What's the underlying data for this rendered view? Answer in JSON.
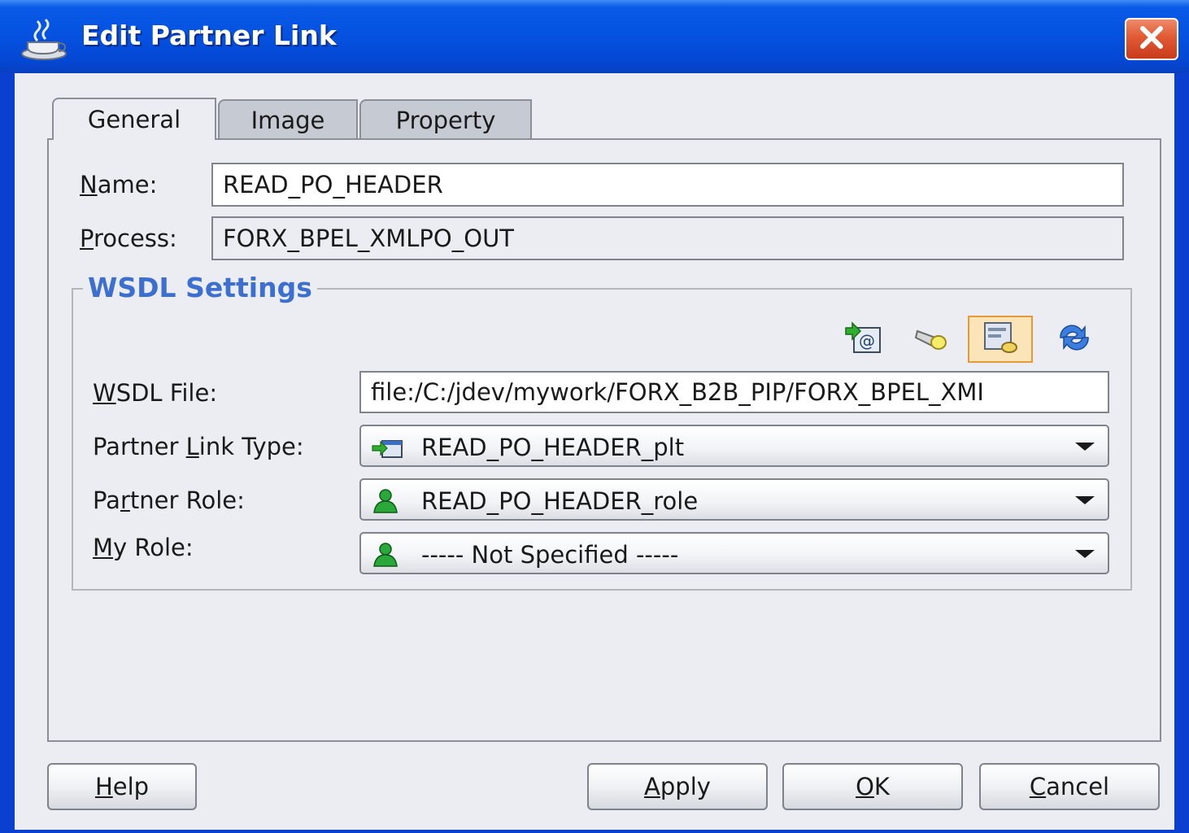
{
  "window": {
    "title": "Edit Partner Link",
    "icon": "coffee-cup-icon",
    "close_icon": "close-icon"
  },
  "tabs": [
    {
      "label": "General",
      "mnemonic": "",
      "active": true
    },
    {
      "label": "Image",
      "active": false
    },
    {
      "label": "Property",
      "active": false
    }
  ],
  "general": {
    "name_label_m": "N",
    "name_label_rest": "ame:",
    "name_value": "READ_PO_HEADER",
    "process_label_m": "P",
    "process_label_rest": "rocess:",
    "process_value": "FORX_BPEL_XMLPO_OUT"
  },
  "wsdl": {
    "group_title": "WSDL Settings",
    "toolbar": [
      "add-wsdl-icon",
      "flashlight-browse-icon",
      "service-explorer-icon",
      "refresh-icon"
    ],
    "wsdl_file_label_pre": "",
    "wsdl_file_label_m": "W",
    "wsdl_file_label_rest": "SDL File:",
    "wsdl_file_value": "file:/C:/jdev/mywork/FORX_B2B_PIP/FORX_BPEL_XMI",
    "plt_label_pre": "Partner ",
    "plt_label_m": "L",
    "plt_label_rest": "ink Type:",
    "plt_value": "READ_PO_HEADER_plt",
    "partner_role_label_pre": "Pa",
    "partner_role_label_m": "r",
    "partner_role_label_rest": "tner Role:",
    "partner_role_value": "READ_PO_HEADER_role",
    "my_role_label_m": "M",
    "my_role_label_rest": "y Role:",
    "my_role_value": "----- Not Specified -----"
  },
  "buttons": {
    "help_m": "H",
    "help_rest": "elp",
    "apply_m": "A",
    "apply_rest": "pply",
    "ok_m": "O",
    "ok_rest": "K",
    "cancel_m": "C",
    "cancel_rest": "ancel"
  },
  "colors": {
    "title_bar": "#0551e0",
    "group_title": "#3c6fcf",
    "client_bg": "#ebedf3",
    "close_button": "#e05a34"
  }
}
